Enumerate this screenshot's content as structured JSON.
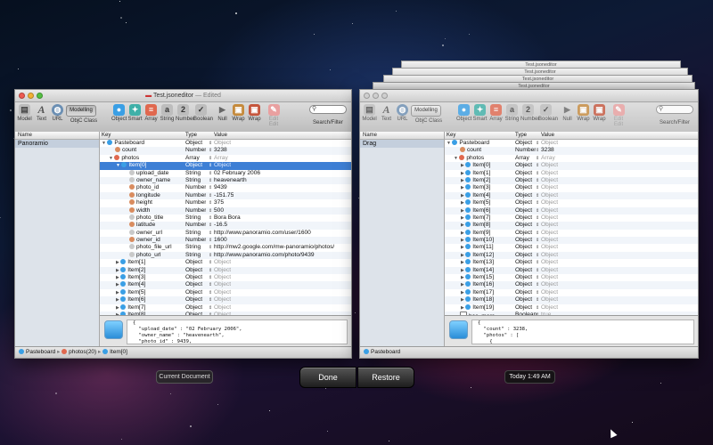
{
  "left_window": {
    "title": "Test.jsoneditor",
    "title_suffix": "— Edited",
    "toolbar": {
      "model": "Model",
      "text": "Text",
      "url": "URL",
      "modelling": "Modelling",
      "objc_class": "ObjC Class",
      "object": "Object",
      "smart": "Smart",
      "array": "Array",
      "string": "String",
      "number": "Number",
      "boolean": "Boolean",
      "null": "Null",
      "wrap1": "Wrap",
      "wrap2": "Wrap",
      "edit_edit": "Edit Edit",
      "search_filter": "Search/Filter"
    },
    "sidebar_header": "Name",
    "sidebar_items": [
      "Panoramio"
    ],
    "columns": {
      "key": "Key",
      "type": "Type",
      "value": "Value"
    },
    "rows": [
      {
        "key": "Pasteboard",
        "type": "Object",
        "value": "Object",
        "grey": true,
        "indent": 0,
        "tri": "▼",
        "icon": "object",
        "sel": false
      },
      {
        "key": "count",
        "type": "Number",
        "value": "3238",
        "grey": false,
        "indent": 1,
        "tri": "",
        "icon": "number",
        "sel": false
      },
      {
        "key": "photos",
        "type": "Array",
        "value": "Array",
        "grey": true,
        "indent": 1,
        "tri": "▼",
        "icon": "array",
        "sel": false
      },
      {
        "key": "Item[0]",
        "type": "Object",
        "value": "Object",
        "grey": true,
        "indent": 2,
        "tri": "▼",
        "icon": "object",
        "sel": true
      },
      {
        "key": "upload_date",
        "type": "String",
        "value": "02 February 2006",
        "grey": false,
        "indent": 3,
        "tri": "",
        "icon": "string",
        "sel": false
      },
      {
        "key": "owner_name",
        "type": "String",
        "value": "heavenearth",
        "grey": false,
        "indent": 3,
        "tri": "",
        "icon": "string",
        "sel": false
      },
      {
        "key": "photo_id",
        "type": "Number",
        "value": "9439",
        "grey": false,
        "indent": 3,
        "tri": "",
        "icon": "number",
        "sel": false
      },
      {
        "key": "longitude",
        "type": "Number",
        "value": "-151.75",
        "grey": false,
        "indent": 3,
        "tri": "",
        "icon": "number",
        "sel": false
      },
      {
        "key": "height",
        "type": "Number",
        "value": "375",
        "grey": false,
        "indent": 3,
        "tri": "",
        "icon": "number",
        "sel": false
      },
      {
        "key": "width",
        "type": "Number",
        "value": "500",
        "grey": false,
        "indent": 3,
        "tri": "",
        "icon": "number",
        "sel": false
      },
      {
        "key": "photo_title",
        "type": "String",
        "value": "Bora Bora",
        "grey": false,
        "indent": 3,
        "tri": "",
        "icon": "string",
        "sel": false
      },
      {
        "key": "latitude",
        "type": "Number",
        "value": "-16.5",
        "grey": false,
        "indent": 3,
        "tri": "",
        "icon": "number",
        "sel": false
      },
      {
        "key": "owner_url",
        "type": "String",
        "value": "http://www.panoramio.com/user/1600",
        "grey": false,
        "indent": 3,
        "tri": "",
        "icon": "string",
        "sel": false
      },
      {
        "key": "owner_id",
        "type": "Number",
        "value": "1600",
        "grey": false,
        "indent": 3,
        "tri": "",
        "icon": "number",
        "sel": false
      },
      {
        "key": "photo_file_url",
        "type": "String",
        "value": "http://mw2.google.com/mw-panoramio/photos/",
        "grey": false,
        "indent": 3,
        "tri": "",
        "icon": "string",
        "sel": false
      },
      {
        "key": "photo_url",
        "type": "String",
        "value": "http://www.panoramio.com/photo/9439",
        "grey": false,
        "indent": 3,
        "tri": "",
        "icon": "string",
        "sel": false
      },
      {
        "key": "Item[1]",
        "type": "Object",
        "value": "Object",
        "grey": true,
        "indent": 2,
        "tri": "▶",
        "icon": "object",
        "sel": false
      },
      {
        "key": "Item[2]",
        "type": "Object",
        "value": "Object",
        "grey": true,
        "indent": 2,
        "tri": "▶",
        "icon": "object",
        "sel": false
      },
      {
        "key": "Item[3]",
        "type": "Object",
        "value": "Object",
        "grey": true,
        "indent": 2,
        "tri": "▶",
        "icon": "object",
        "sel": false
      },
      {
        "key": "Item[4]",
        "type": "Object",
        "value": "Object",
        "grey": true,
        "indent": 2,
        "tri": "▶",
        "icon": "object",
        "sel": false
      },
      {
        "key": "Item[5]",
        "type": "Object",
        "value": "Object",
        "grey": true,
        "indent": 2,
        "tri": "▶",
        "icon": "object",
        "sel": false
      },
      {
        "key": "Item[6]",
        "type": "Object",
        "value": "Object",
        "grey": true,
        "indent": 2,
        "tri": "▶",
        "icon": "object",
        "sel": false
      },
      {
        "key": "Item[7]",
        "type": "Object",
        "value": "Object",
        "grey": true,
        "indent": 2,
        "tri": "▶",
        "icon": "object",
        "sel": false
      },
      {
        "key": "Item[8]",
        "type": "Object",
        "value": "Object",
        "grey": true,
        "indent": 2,
        "tri": "▶",
        "icon": "object",
        "sel": false
      }
    ],
    "preview_text": "{\n  \"upload_date\" : \"02 February 2006\",\n  \"owner_name\" : \"heavenearth\",\n  \"photo_id\" : 9439,",
    "path": [
      "Pasteboard",
      "photos(20)",
      "Item[0]"
    ]
  },
  "right_window": {
    "stacked_titles": [
      "Test.jsoneditor",
      "Test.jsoneditor",
      "Test.jsoneditor",
      "Test.jsoneditor"
    ],
    "toolbar": {
      "model": "Model",
      "text": "Text",
      "url": "URL",
      "modelling": "Modelling",
      "objc_class": "ObjC Class",
      "object": "Object",
      "smart": "Smart",
      "array": "Array",
      "string": "String",
      "number": "Number",
      "boolean": "Boolean",
      "null": "Null",
      "wrap1": "Wrap",
      "wrap2": "Wrap",
      "edit_edit": "Edit Edit",
      "search_filter": "Search/Filter"
    },
    "sidebar_header": "Name",
    "sidebar_items": [
      "Drag"
    ],
    "columns": {
      "key": "Key",
      "type": "Type",
      "value": "Value"
    },
    "rows": [
      {
        "key": "Pasteboard",
        "type": "Object",
        "value": "Object",
        "grey": true,
        "indent": 0,
        "tri": "▼",
        "icon": "object"
      },
      {
        "key": "count",
        "type": "Number",
        "value": "3238",
        "grey": false,
        "indent": 1,
        "tri": "",
        "icon": "number"
      },
      {
        "key": "photos",
        "type": "Array",
        "value": "Array",
        "grey": true,
        "indent": 1,
        "tri": "▼",
        "icon": "array"
      },
      {
        "key": "Item[0]",
        "type": "Object",
        "value": "Object",
        "grey": true,
        "indent": 2,
        "tri": "▶",
        "icon": "object"
      },
      {
        "key": "Item[1]",
        "type": "Object",
        "value": "Object",
        "grey": true,
        "indent": 2,
        "tri": "▶",
        "icon": "object"
      },
      {
        "key": "Item[2]",
        "type": "Object",
        "value": "Object",
        "grey": true,
        "indent": 2,
        "tri": "▶",
        "icon": "object"
      },
      {
        "key": "Item[3]",
        "type": "Object",
        "value": "Object",
        "grey": true,
        "indent": 2,
        "tri": "▶",
        "icon": "object"
      },
      {
        "key": "Item[4]",
        "type": "Object",
        "value": "Object",
        "grey": true,
        "indent": 2,
        "tri": "▶",
        "icon": "object"
      },
      {
        "key": "Item[5]",
        "type": "Object",
        "value": "Object",
        "grey": true,
        "indent": 2,
        "tri": "▶",
        "icon": "object"
      },
      {
        "key": "Item[6]",
        "type": "Object",
        "value": "Object",
        "grey": true,
        "indent": 2,
        "tri": "▶",
        "icon": "object"
      },
      {
        "key": "Item[7]",
        "type": "Object",
        "value": "Object",
        "grey": true,
        "indent": 2,
        "tri": "▶",
        "icon": "object"
      },
      {
        "key": "Item[8]",
        "type": "Object",
        "value": "Object",
        "grey": true,
        "indent": 2,
        "tri": "▶",
        "icon": "object"
      },
      {
        "key": "Item[9]",
        "type": "Object",
        "value": "Object",
        "grey": true,
        "indent": 2,
        "tri": "▶",
        "icon": "object"
      },
      {
        "key": "Item[10]",
        "type": "Object",
        "value": "Object",
        "grey": true,
        "indent": 2,
        "tri": "▶",
        "icon": "object"
      },
      {
        "key": "Item[11]",
        "type": "Object",
        "value": "Object",
        "grey": true,
        "indent": 2,
        "tri": "▶",
        "icon": "object"
      },
      {
        "key": "Item[12]",
        "type": "Object",
        "value": "Object",
        "grey": true,
        "indent": 2,
        "tri": "▶",
        "icon": "object"
      },
      {
        "key": "Item[13]",
        "type": "Object",
        "value": "Object",
        "grey": true,
        "indent": 2,
        "tri": "▶",
        "icon": "object"
      },
      {
        "key": "Item[14]",
        "type": "Object",
        "value": "Object",
        "grey": true,
        "indent": 2,
        "tri": "▶",
        "icon": "object"
      },
      {
        "key": "Item[15]",
        "type": "Object",
        "value": "Object",
        "grey": true,
        "indent": 2,
        "tri": "▶",
        "icon": "object"
      },
      {
        "key": "Item[16]",
        "type": "Object",
        "value": "Object",
        "grey": true,
        "indent": 2,
        "tri": "▶",
        "icon": "object"
      },
      {
        "key": "Item[17]",
        "type": "Object",
        "value": "Object",
        "grey": true,
        "indent": 2,
        "tri": "▶",
        "icon": "object"
      },
      {
        "key": "Item[18]",
        "type": "Object",
        "value": "Object",
        "grey": true,
        "indent": 2,
        "tri": "▶",
        "icon": "object"
      },
      {
        "key": "Item[19]",
        "type": "Object",
        "value": "Object",
        "grey": true,
        "indent": 2,
        "tri": "▶",
        "icon": "object"
      },
      {
        "key": "has_more",
        "type": "Boolean",
        "value": "true",
        "grey": true,
        "indent": 1,
        "tri": "",
        "icon": "boolean"
      }
    ],
    "preview_text": "{\n  \"count\" : 3238,\n  \"photos\" : [\n    {",
    "path": [
      "Pasteboard"
    ]
  },
  "bottom": {
    "current_document": "Current Document",
    "done": "Done",
    "restore": "Restore",
    "timestamp": "Today 1:49 AM"
  },
  "colors": {
    "selection": "#3d7fd5",
    "object_icon": "#3a9fe5",
    "string_icon": "#c9c9c9",
    "number_icon": "#d98c5f",
    "array_icon": "#e0684f"
  }
}
